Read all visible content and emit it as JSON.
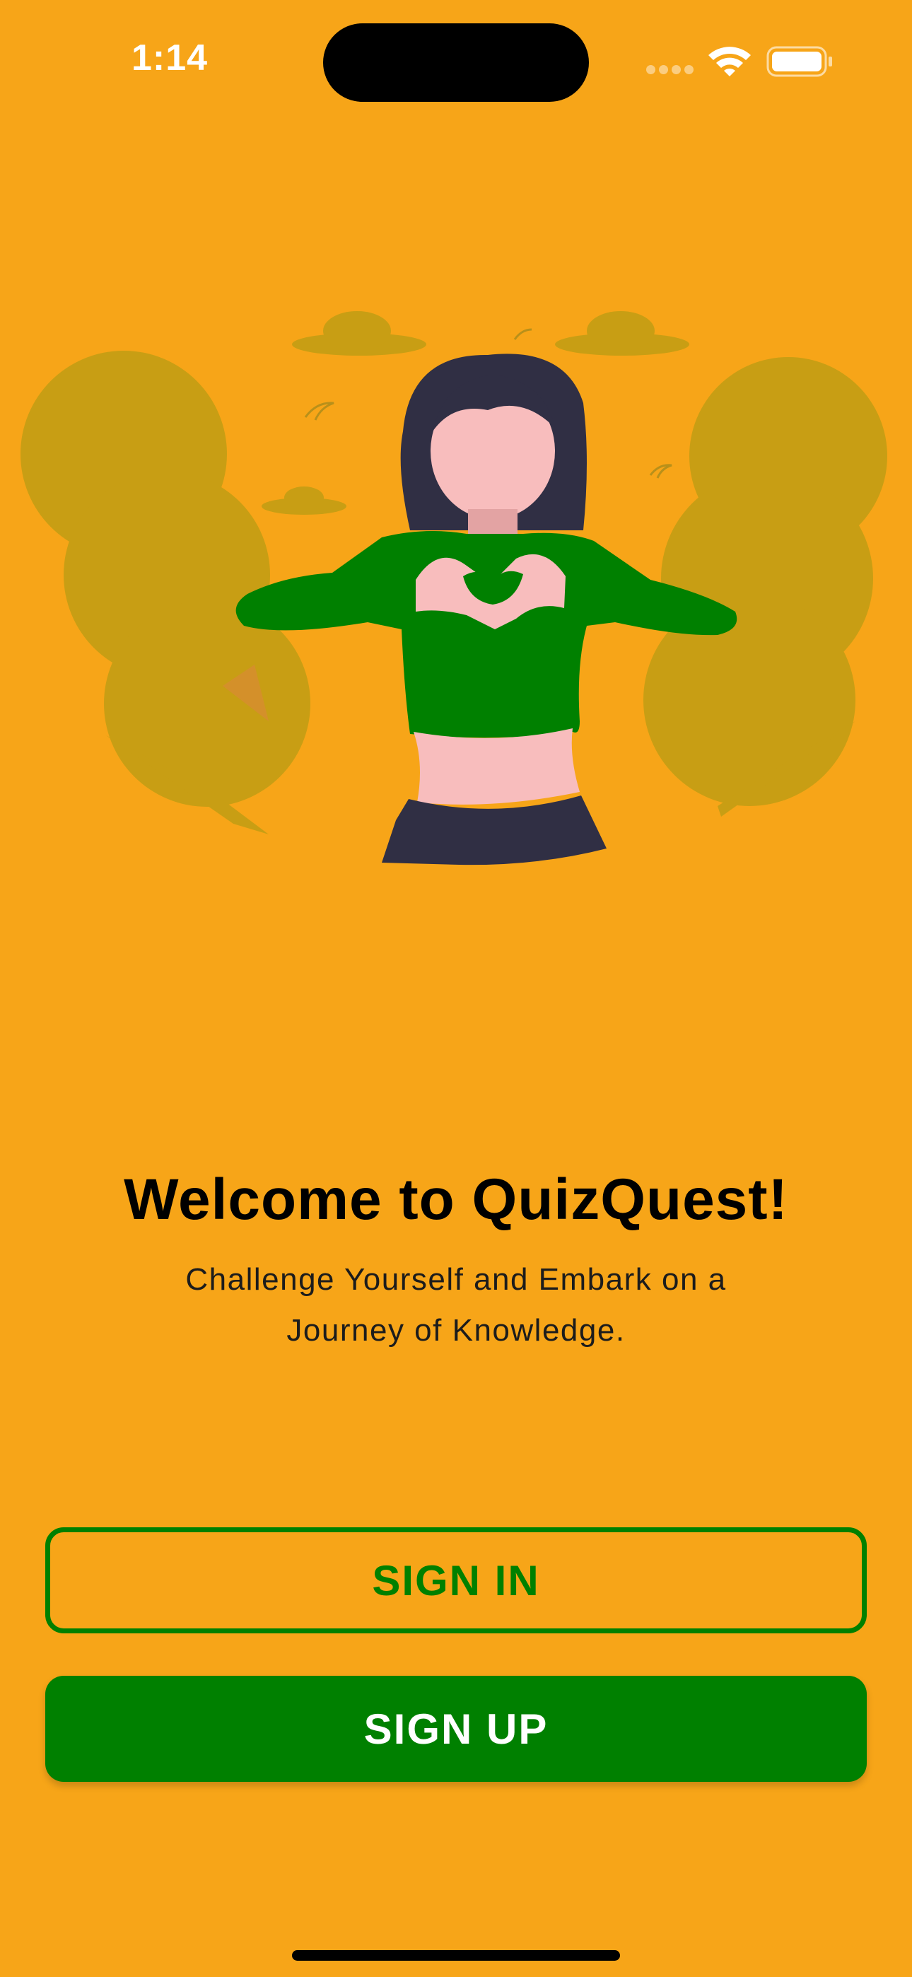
{
  "status_bar": {
    "time": "1:14"
  },
  "welcome": {
    "title": "Welcome to QuizQuest!",
    "subtitle": "Challenge Yourself and Embark on a Journey of Knowledge."
  },
  "buttons": {
    "sign_in": "SIGN IN",
    "sign_up": "SIGN UP"
  },
  "colors": {
    "background": "#F7A518",
    "accent": "#008000",
    "plant": "#C89E14",
    "hair": "#302F44",
    "skin": "#F8BDBD"
  },
  "icons": [
    "signal-icon",
    "wifi-icon",
    "battery-icon"
  ]
}
